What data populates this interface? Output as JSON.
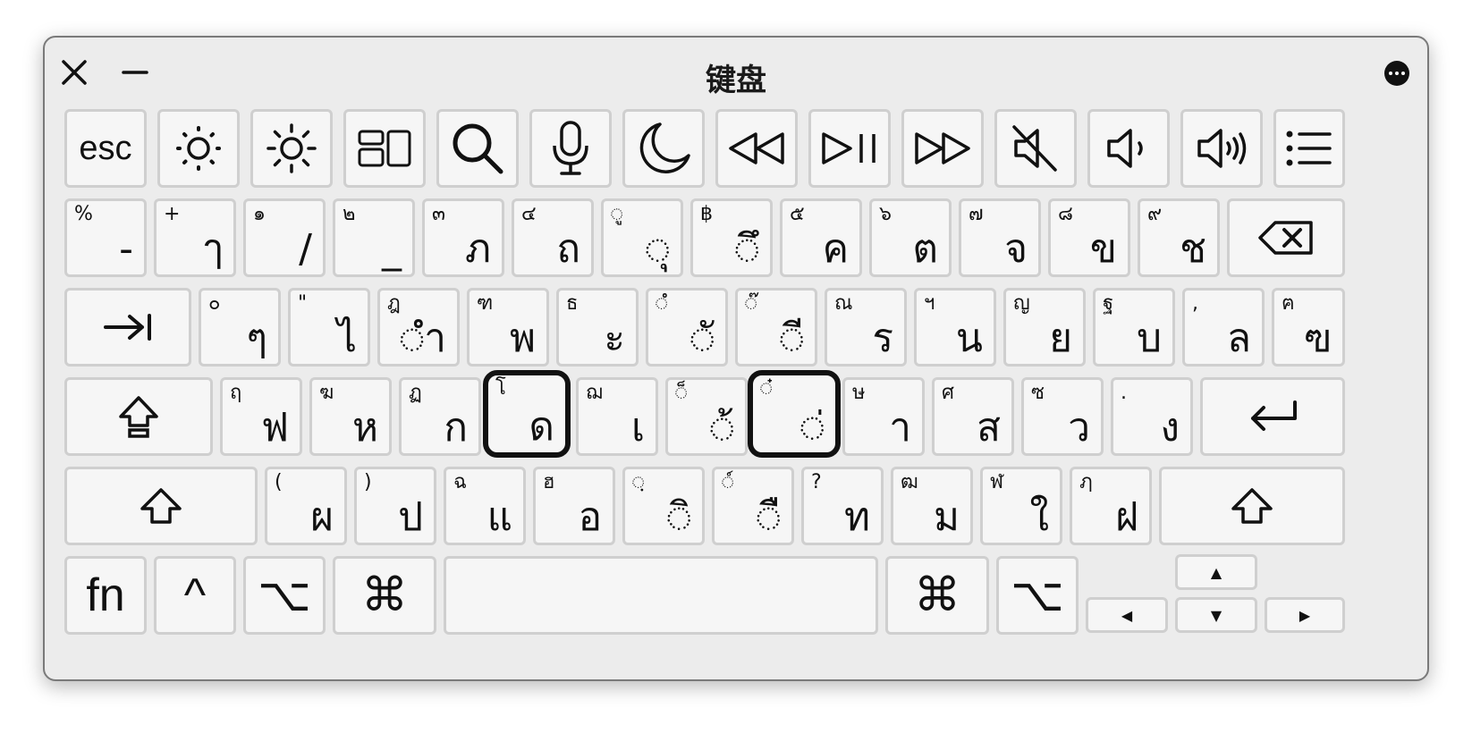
{
  "window": {
    "title": "键盘"
  },
  "icons": {
    "close": "close-icon",
    "minimize": "minimize-icon",
    "more": "more-options-icon"
  },
  "row_fn": [
    {
      "label": "esc"
    }
  ],
  "row_num": [
    {
      "alt": "%",
      "main": "-"
    },
    {
      "alt": "+",
      "main": "ๅ"
    },
    {
      "alt": "๑",
      "main": "/"
    },
    {
      "alt": "๒",
      "main": "_"
    },
    {
      "alt": "๓",
      "main": "ภ"
    },
    {
      "alt": "๔",
      "main": "ถ"
    },
    {
      "alt": "◌ู",
      "main": "◌ุ"
    },
    {
      "alt": "฿",
      "main": "◌ึ"
    },
    {
      "alt": "๕",
      "main": "ค"
    },
    {
      "alt": "๖",
      "main": "ต"
    },
    {
      "alt": "๗",
      "main": "จ"
    },
    {
      "alt": "๘",
      "main": "ข"
    },
    {
      "alt": "๙",
      "main": "ช"
    }
  ],
  "row_q": [
    {
      "alt": "๐",
      "main": "ๆ"
    },
    {
      "alt": "\"",
      "main": "ไ"
    },
    {
      "alt": "ฎ",
      "main": "◌ำ"
    },
    {
      "alt": "ฑ",
      "main": "พ"
    },
    {
      "alt": "ธ",
      "main": "ะ"
    },
    {
      "alt": "◌ํ",
      "main": "◌ั"
    },
    {
      "alt": "◌๊",
      "main": "◌ี"
    },
    {
      "alt": "ณ",
      "main": "ร"
    },
    {
      "alt": "ฯ",
      "main": "น"
    },
    {
      "alt": "ญ",
      "main": "ย"
    },
    {
      "alt": "ฐ",
      "main": "บ"
    },
    {
      "alt": ",",
      "main": "ล"
    },
    {
      "alt": "ฅ",
      "main": "ฃ"
    }
  ],
  "row_a": [
    {
      "alt": "ฤ",
      "main": "ฟ"
    },
    {
      "alt": "ฆ",
      "main": "ห"
    },
    {
      "alt": "ฏ",
      "main": "ก"
    },
    {
      "alt": "โ",
      "main": "ด"
    },
    {
      "alt": "ฌ",
      "main": "เ"
    },
    {
      "alt": "◌็",
      "main": "◌้"
    },
    {
      "alt": "◌๋",
      "main": "◌่"
    },
    {
      "alt": "ษ",
      "main": "า"
    },
    {
      "alt": "ศ",
      "main": "ส"
    },
    {
      "alt": "ซ",
      "main": "ว"
    },
    {
      "alt": ".",
      "main": "ง"
    }
  ],
  "row_z": [
    {
      "alt": "(",
      "main": "ผ"
    },
    {
      "alt": ")",
      "main": "ป"
    },
    {
      "alt": "ฉ",
      "main": "แ"
    },
    {
      "alt": "ฮ",
      "main": "อ"
    },
    {
      "alt": "◌ฺ",
      "main": "◌ิ"
    },
    {
      "alt": "◌์",
      "main": "◌ื"
    },
    {
      "alt": "?",
      "main": "ท"
    },
    {
      "alt": "ฒ",
      "main": "ม"
    },
    {
      "alt": "ฬ",
      "main": "ใ"
    },
    {
      "alt": "ฦ",
      "main": "ฝ"
    }
  ],
  "row_bottom": {
    "fn": "fn",
    "ctrl": "^",
    "opt": "⌥",
    "cmd": "⌘",
    "up": "▲",
    "down": "▼",
    "left": "◀",
    "right": "▶"
  }
}
